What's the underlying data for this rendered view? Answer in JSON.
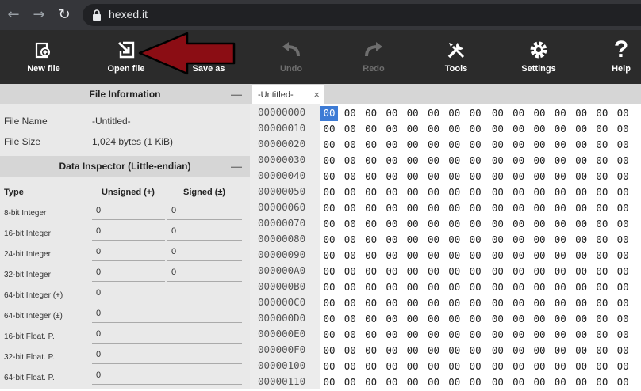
{
  "browser": {
    "url": "hexed.it"
  },
  "toolbar": {
    "buttons": [
      {
        "label": "New file"
      },
      {
        "label": "Open file"
      },
      {
        "label": "Save as"
      },
      {
        "label": "Undo"
      },
      {
        "label": "Redo"
      },
      {
        "label": "Tools"
      },
      {
        "label": "Settings"
      },
      {
        "label": "Help"
      }
    ]
  },
  "file_info": {
    "title": "File Information",
    "name_label": "File Name",
    "name_value": "-Untitled-",
    "size_label": "File Size",
    "size_value": "1,024 bytes (1 KiB)"
  },
  "inspector": {
    "title": "Data Inspector (Little-endian)",
    "col_type": "Type",
    "col_unsigned": "Unsigned (+)",
    "col_signed": "Signed (±)",
    "rows": [
      {
        "label": "8-bit Integer",
        "unsigned": "0",
        "signed": "0"
      },
      {
        "label": "16-bit Integer",
        "unsigned": "0",
        "signed": "0"
      },
      {
        "label": "24-bit Integer",
        "unsigned": "0",
        "signed": "0"
      },
      {
        "label": "32-bit Integer",
        "unsigned": "0",
        "signed": "0"
      },
      {
        "label": "64-bit Integer (+)",
        "value": "0"
      },
      {
        "label": "64-bit Integer (±)",
        "value": "0"
      },
      {
        "label": "16-bit Float. P.",
        "value": "0"
      },
      {
        "label": "32-bit Float. P.",
        "value": "0"
      },
      {
        "label": "64-bit Float. P.",
        "value": "0"
      }
    ]
  },
  "editor": {
    "tab_label": "-Untitled-",
    "offsets": [
      "00000000",
      "00000010",
      "00000020",
      "00000030",
      "00000040",
      "00000050",
      "00000060",
      "00000070",
      "00000080",
      "00000090",
      "000000A0",
      "000000B0",
      "000000C0",
      "000000D0",
      "000000E0",
      "000000F0",
      "00000100",
      "00000110"
    ],
    "byte_value": "00",
    "bytes_per_row": 15,
    "selected_offset": "00000000"
  },
  "colors": {
    "accent": "#3d7bd5",
    "arrow": "#8b0d14"
  }
}
